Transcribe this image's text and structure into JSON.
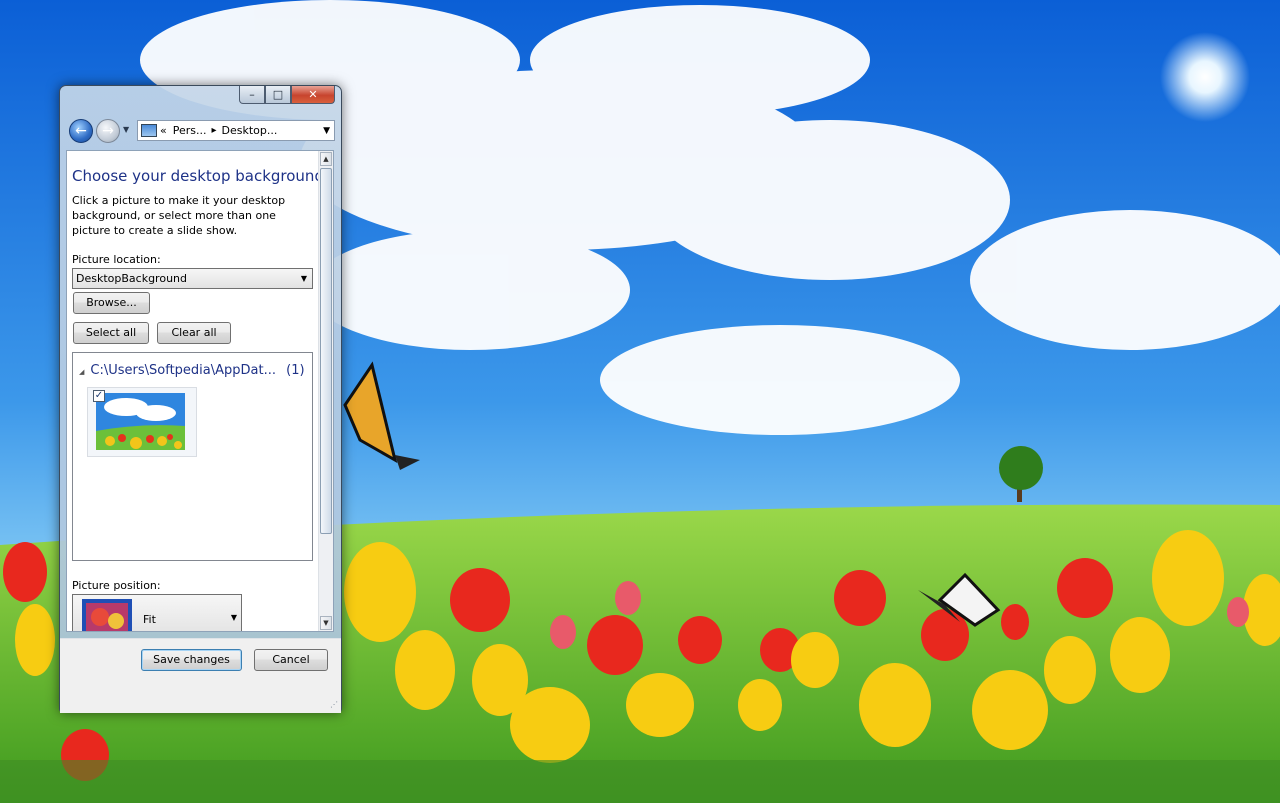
{
  "window": {
    "caption_buttons": [
      "minimize-icon",
      "maximize-icon",
      "close-icon"
    ]
  },
  "navigation": {
    "back_icon": "back-arrow-icon",
    "forward_icon": "forward-arrow-icon",
    "address": {
      "overflow": "«",
      "crumb1": "Pers...",
      "crumb2": "Desktop..."
    }
  },
  "content": {
    "heading": "Choose your desktop background",
    "description": "Click a picture to make it your desktop background, or select more than one picture to create a slide show.",
    "picture_location_label": "Picture location:",
    "picture_location_value": "DesktopBackground",
    "browse_label": "Browse...",
    "select_all_label": "Select all",
    "clear_all_label": "Clear all",
    "group_header": "C:\\Users\\Softpedia\\AppDat...",
    "group_count": "(1)",
    "thumbnail_checked": true,
    "picture_position_label": "Picture position:",
    "picture_position_value": "Fit"
  },
  "footer": {
    "save_label": "Save changes",
    "cancel_label": "Cancel"
  },
  "colors": {
    "heading": "#1e3287",
    "sky": "#2d7fd8",
    "grass": "#5fb52c"
  }
}
